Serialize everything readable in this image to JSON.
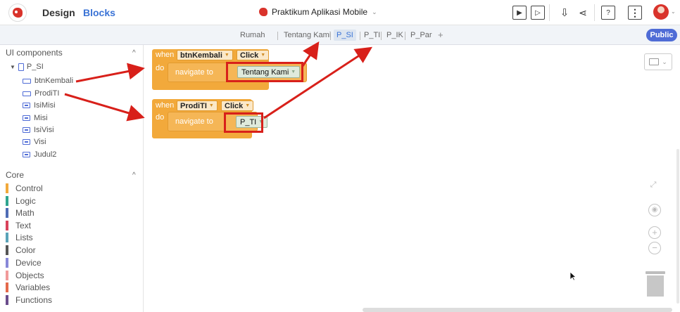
{
  "header": {
    "design_tab": "Design",
    "blocks_tab": "Blocks",
    "project_name": "Praktikum Aplikasi Mobile",
    "help_label": "?",
    "more_label": "⋮"
  },
  "screens": {
    "tabs": [
      "Rumah",
      "Tentang Kami",
      "P_SI",
      "P_TI",
      "P_IK",
      "P_Par"
    ],
    "active": "P_SI",
    "add_label": "+"
  },
  "public_label": "Public",
  "sidebar": {
    "components_title": "UI components",
    "components_collapse": "^",
    "screen_name": "P_SI",
    "components": [
      {
        "name": "btnKembali",
        "icon": "button-icon"
      },
      {
        "name": "ProdiTI",
        "icon": "button-icon"
      },
      {
        "name": "IsiMisi",
        "icon": "label-icon"
      },
      {
        "name": "Misi",
        "icon": "label-icon"
      },
      {
        "name": "IsiVisi",
        "icon": "label-icon"
      },
      {
        "name": "Visi",
        "icon": "label-icon"
      },
      {
        "name": "Judul2",
        "icon": "label-icon"
      }
    ],
    "core_title": "Core",
    "core_collapse": "^",
    "categories": [
      {
        "name": "Control",
        "color": "#f2a93b"
      },
      {
        "name": "Logic",
        "color": "#2fa58f"
      },
      {
        "name": "Math",
        "color": "#4f6cb5"
      },
      {
        "name": "Text",
        "color": "#d9425b"
      },
      {
        "name": "Lists",
        "color": "#5aa3b8"
      },
      {
        "name": "Color",
        "color": "#555555"
      },
      {
        "name": "Device",
        "color": "#8888d8"
      },
      {
        "name": "Objects",
        "color": "#f19a9a"
      },
      {
        "name": "Variables",
        "color": "#e4694a"
      },
      {
        "name": "Functions",
        "color": "#6a4d8c"
      }
    ]
  },
  "blocks": [
    {
      "when": "when",
      "component": "btnKembali",
      "event": "Click",
      "do": "do",
      "action": "navigate to",
      "target": "Tentang Kami"
    },
    {
      "when": "when",
      "component": "ProdiTI",
      "event": "Click",
      "do": "do",
      "action": "navigate to",
      "target": "P_TI"
    }
  ],
  "colors": {
    "accent": "#3a73d6",
    "event_block": "#f2a93b",
    "annotation": "#d8201a",
    "public_button": "#4f6cd6"
  }
}
